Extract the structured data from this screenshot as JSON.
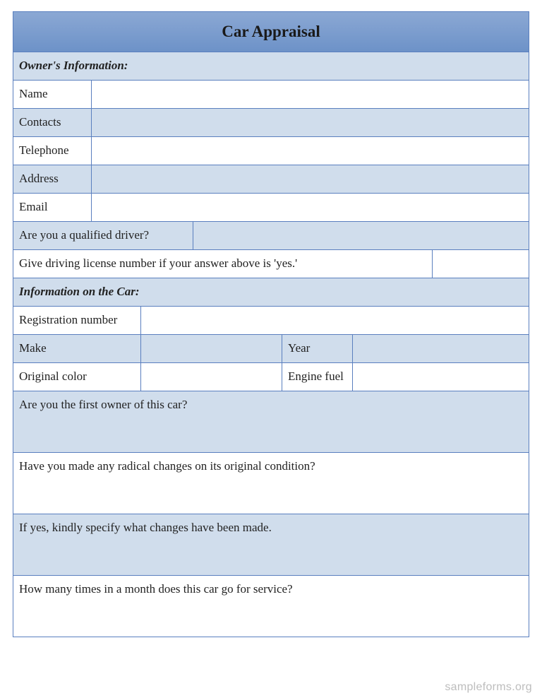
{
  "title": "Car Appraisal",
  "sections": {
    "owner_heading": "Owner's Information:",
    "car_heading": "Information on the Car:"
  },
  "owner": {
    "name_label": "Name",
    "name_value": "",
    "contacts_label": "Contacts",
    "contacts_value": "",
    "telephone_label": "Telephone",
    "telephone_value": "",
    "address_label": "Address",
    "address_value": "",
    "email_label": "Email",
    "email_value": "",
    "qualified_label": "Are you a qualified driver?",
    "qualified_value": "",
    "license_label": "Give driving license number if your answer above is 'yes.'",
    "license_value": ""
  },
  "car": {
    "registration_label": "Registration number",
    "registration_value": "",
    "make_label": "Make",
    "make_value": "",
    "year_label": "Year",
    "year_value": "",
    "color_label": "Original color",
    "color_value": "",
    "fuel_label": "Engine fuel",
    "fuel_value": "",
    "first_owner_label": "Are you the first owner of this car?",
    "first_owner_value": "",
    "changes_label": "Have you made any radical changes on its original condition?",
    "changes_value": "",
    "specify_label": "If yes, kindly specify what changes have been made.",
    "specify_value": "",
    "service_label": "How many times in a month does this car go for service?",
    "service_value": ""
  },
  "watermark": "sampleforms.org"
}
